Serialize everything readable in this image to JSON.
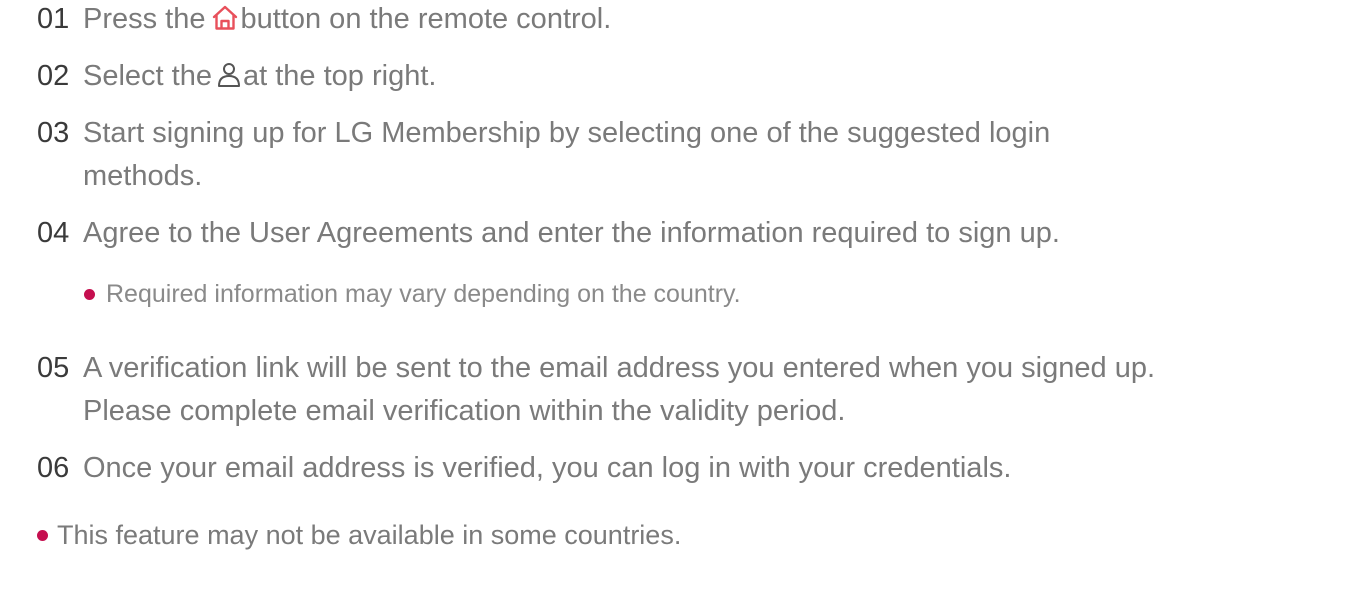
{
  "steps": [
    {
      "num": "01",
      "parts": [
        "Press the",
        "button on the remote control."
      ],
      "icon": "home-icon"
    },
    {
      "num": "02",
      "parts": [
        "Select the",
        "at the top right."
      ],
      "icon": "user-icon"
    },
    {
      "num": "03",
      "lines": [
        "Start signing up for LG Membership by selecting one of the suggested login",
        "methods."
      ]
    },
    {
      "num": "04",
      "lines": [
        "Agree to the User Agreements and enter the information required to sign up."
      ]
    },
    {
      "num": "05",
      "lines": [
        "A verification link will be sent to the email address you entered when you signed up.",
        "Please complete email verification within the validity period."
      ]
    },
    {
      "num": "06",
      "lines": [
        "Once your email address is verified, you can log in with your credentials."
      ]
    }
  ],
  "sub_bullet": "Required information may vary depending on the country.",
  "note": "This feature may not be available in some countries.",
  "colors": {
    "accent": "#c50f4f",
    "home_icon": "#e8505b",
    "text": "#7a7a7a",
    "number": "#3a3a3a"
  }
}
